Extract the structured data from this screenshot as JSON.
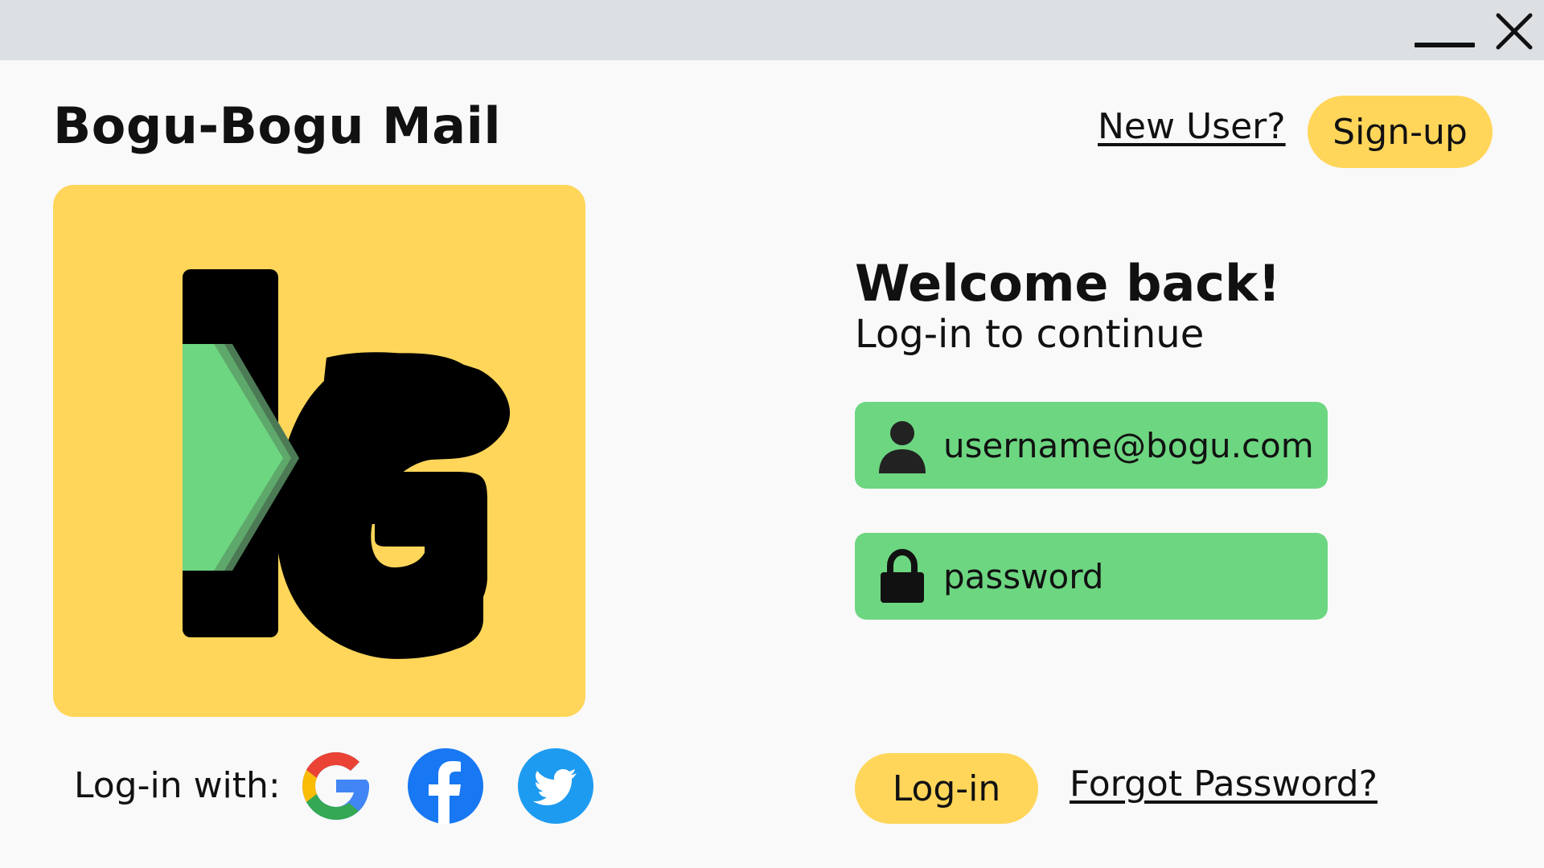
{
  "window": {
    "minimize_icon": "minimize-icon",
    "close_icon": "close-icon"
  },
  "header": {
    "app_title": "Bogu-Bogu Mail",
    "new_user_link": "New User?",
    "signup_label": "Sign-up"
  },
  "logo": {
    "icon": "bogu-logo",
    "background_color": "#ffd65a",
    "accent_color": "#6dd681"
  },
  "welcome": {
    "title": "Welcome back!",
    "subtitle": "Log-in to continue"
  },
  "form": {
    "username_placeholder": "username@bogu.com",
    "username_icon": "user-icon",
    "password_placeholder": "password",
    "password_icon": "lock-icon",
    "field_color": "#6dd681"
  },
  "social_login": {
    "label": "Log-in with:",
    "providers": [
      {
        "name": "Google",
        "icon": "google-icon"
      },
      {
        "name": "Facebook",
        "icon": "facebook-icon"
      },
      {
        "name": "Twitter",
        "icon": "twitter-icon"
      }
    ]
  },
  "actions": {
    "login_label": "Log-in",
    "forgot_password_link": "Forgot Password?",
    "button_color": "#ffd65a"
  }
}
